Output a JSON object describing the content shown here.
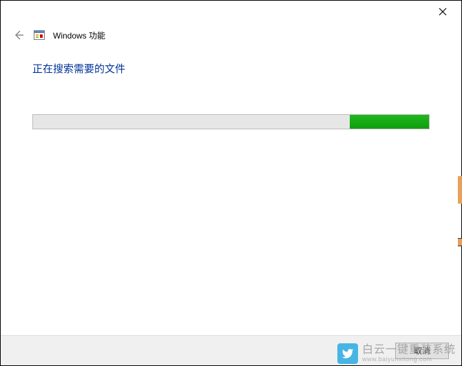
{
  "header": {
    "title": "Windows 功能"
  },
  "content": {
    "status_message": "正在搜索需要的文件",
    "progress": {
      "fill_percent": 20,
      "fill_position": "right"
    }
  },
  "footer": {
    "cancel_label": "取消"
  },
  "watermark": {
    "main_text": "白云一键重装系统",
    "url_text": "www.baiyunxitong.com"
  }
}
